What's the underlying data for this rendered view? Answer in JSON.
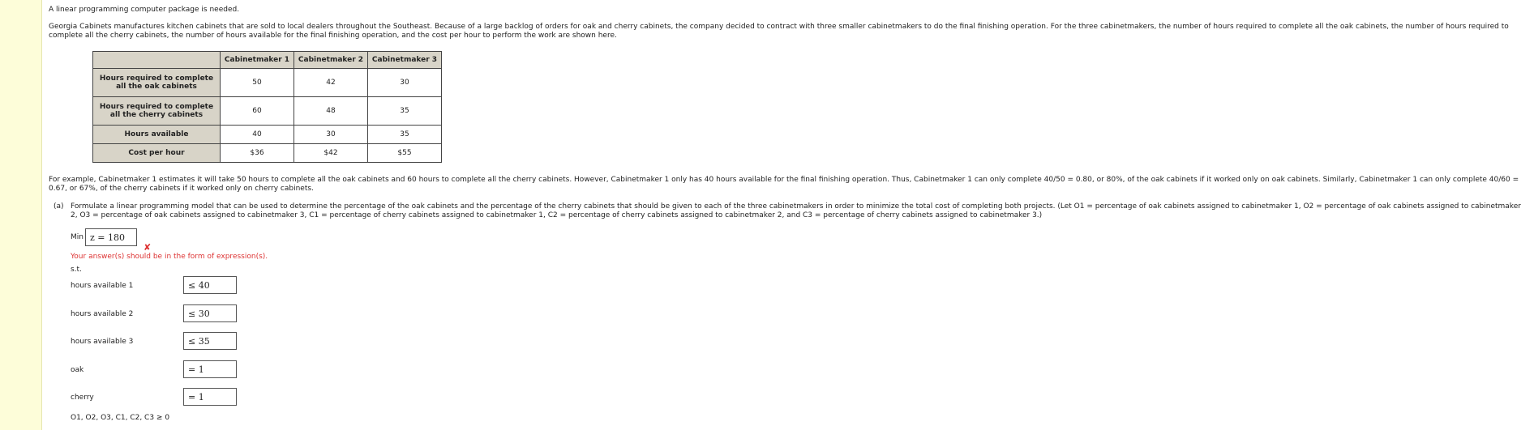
{
  "intro": "A linear programming computer package is needed.",
  "paragraph1": "Georgia Cabinets manufactures kitchen cabinets that are sold to local dealers throughout the Southeast. Because of a large backlog of orders for oak and cherry cabinets, the company decided to contract with three smaller cabinetmakers to do the final finishing operation. For the three cabinetmakers, the number of hours required to complete all the oak cabinets, the number of hours required to complete all the cherry cabinets, the number of hours available for the final finishing operation, and the cost per hour to perform the work are shown here.",
  "table": {
    "headers": [
      "Cabinetmaker 1",
      "Cabinetmaker 2",
      "Cabinetmaker 3"
    ],
    "rows": [
      {
        "label": "Hours required to complete all the oak cabinets",
        "values": [
          "50",
          "42",
          "30"
        ]
      },
      {
        "label": "Hours required to complete all the cherry cabinets",
        "values": [
          "60",
          "48",
          "35"
        ]
      },
      {
        "label": "Hours available",
        "values": [
          "40",
          "30",
          "35"
        ]
      },
      {
        "label": "Cost per hour",
        "values": [
          "$36",
          "$42",
          "$55"
        ]
      }
    ]
  },
  "paragraph2": "For example, Cabinetmaker 1 estimates it will take 50 hours to complete all the oak cabinets and 60 hours to complete all the cherry cabinets. However, Cabinetmaker 1 only has 40 hours available for the final finishing operation. Thus, Cabinetmaker 1 can only complete 40/50 = 0.80, or 80%, of the oak cabinets if it worked only on oak cabinets. Similarly, Cabinetmaker 1 can only complete 40/60 = 0.67, or 67%, of the cherry cabinets if it worked only on cherry cabinets.",
  "partA": {
    "label": "(a)",
    "text": "Formulate a linear programming model that can be used to determine the percentage of the oak cabinets and the percentage of the cherry cabinets that should be given to each of the three cabinetmakers in order to minimize the total cost of completing both projects. (Let O1 = percentage of oak cabinets assigned to cabinetmaker 1, O2 = percentage of oak cabinets assigned to cabinetmaker 2, O3 = percentage of oak cabinets assigned to cabinetmaker 3, C1 = percentage of cherry cabinets assigned to cabinetmaker 1, C2 = percentage of cherry cabinets assigned to cabinetmaker 2, and C3 = percentage of cherry cabinets assigned to cabinetmaker 3.)",
    "min_label": "Min",
    "objective_value": "z = 180",
    "error_icon": "✘",
    "error_message": "Your answer(s) should be in the form of expression(s).",
    "st_label": "s.t.",
    "constraints": [
      {
        "label": "hours available 1",
        "value": "≤ 40"
      },
      {
        "label": "hours available 2",
        "value": "≤ 30"
      },
      {
        "label": "hours available 3",
        "value": "≤ 35"
      },
      {
        "label": "oak",
        "value": "= 1"
      },
      {
        "label": "cherry",
        "value": "= 1"
      }
    ],
    "nonnegativity": "O1, O2, O3, C1, C2, C3 ≥ 0"
  }
}
